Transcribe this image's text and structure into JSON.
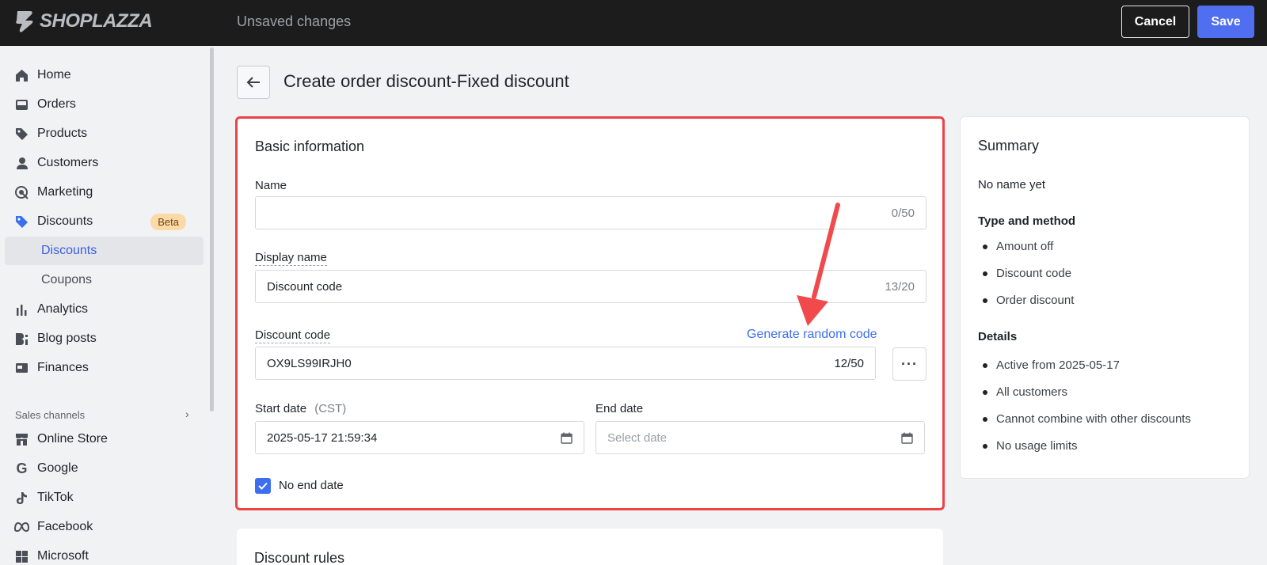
{
  "topbar": {
    "brand": "SHOPLAZZA",
    "status": "Unsaved changes",
    "cancel_label": "Cancel",
    "save_label": "Save"
  },
  "sidebar": {
    "items": [
      {
        "label": "Home",
        "icon": "home-icon"
      },
      {
        "label": "Orders",
        "icon": "inbox-icon"
      },
      {
        "label": "Products",
        "icon": "tag-icon"
      },
      {
        "label": "Customers",
        "icon": "person-icon"
      },
      {
        "label": "Marketing",
        "icon": "target-icon"
      },
      {
        "label": "Discounts",
        "icon": "discount-tag-icon",
        "badge": "Beta"
      },
      {
        "label": "Discounts",
        "sub": true,
        "active": true
      },
      {
        "label": "Coupons",
        "sub": true
      },
      {
        "label": "Analytics",
        "icon": "bar-chart-icon"
      },
      {
        "label": "Blog posts",
        "icon": "blog-icon"
      },
      {
        "label": "Finances",
        "icon": "finance-icon"
      }
    ],
    "section_label": "Sales channels",
    "channels": [
      {
        "label": "Online Store",
        "icon": "store-icon"
      },
      {
        "label": "Google",
        "icon": "google-icon"
      },
      {
        "label": "TikTok",
        "icon": "tiktok-icon"
      },
      {
        "label": "Facebook",
        "icon": "meta-icon"
      },
      {
        "label": "Microsoft",
        "icon": "microsoft-icon"
      }
    ]
  },
  "page": {
    "title": "Create order discount-Fixed discount"
  },
  "basic": {
    "title": "Basic information",
    "name_label": "Name",
    "name_value": "",
    "name_count": "0/50",
    "display_label": "Display name",
    "display_value": "Discount code",
    "display_count": "13/20",
    "code_label": "Discount code",
    "generate_link": "Generate random code",
    "code_value": "OX9LS99IRJH0",
    "code_count": "12/50",
    "more_label": "···",
    "start_label": "Start date",
    "start_tz": "(CST)",
    "start_value": "2025-05-17 21:59:34",
    "end_label": "End date",
    "end_placeholder": "Select date",
    "no_end_label": "No end date",
    "no_end_checked": true
  },
  "summary": {
    "title": "Summary",
    "name": "No name yet",
    "type_head": "Type and method",
    "type_items": [
      "Amount off",
      "Discount code",
      "Order discount"
    ],
    "details_head": "Details",
    "details_items": [
      "Active from 2025-05-17",
      "All customers",
      "Cannot combine with other discounts",
      "No usage limits"
    ]
  },
  "rules": {
    "title": "Discount rules"
  },
  "colors": {
    "accent": "#4f6ff0",
    "highlight": "#ed4346",
    "link": "#3d6ef0"
  }
}
